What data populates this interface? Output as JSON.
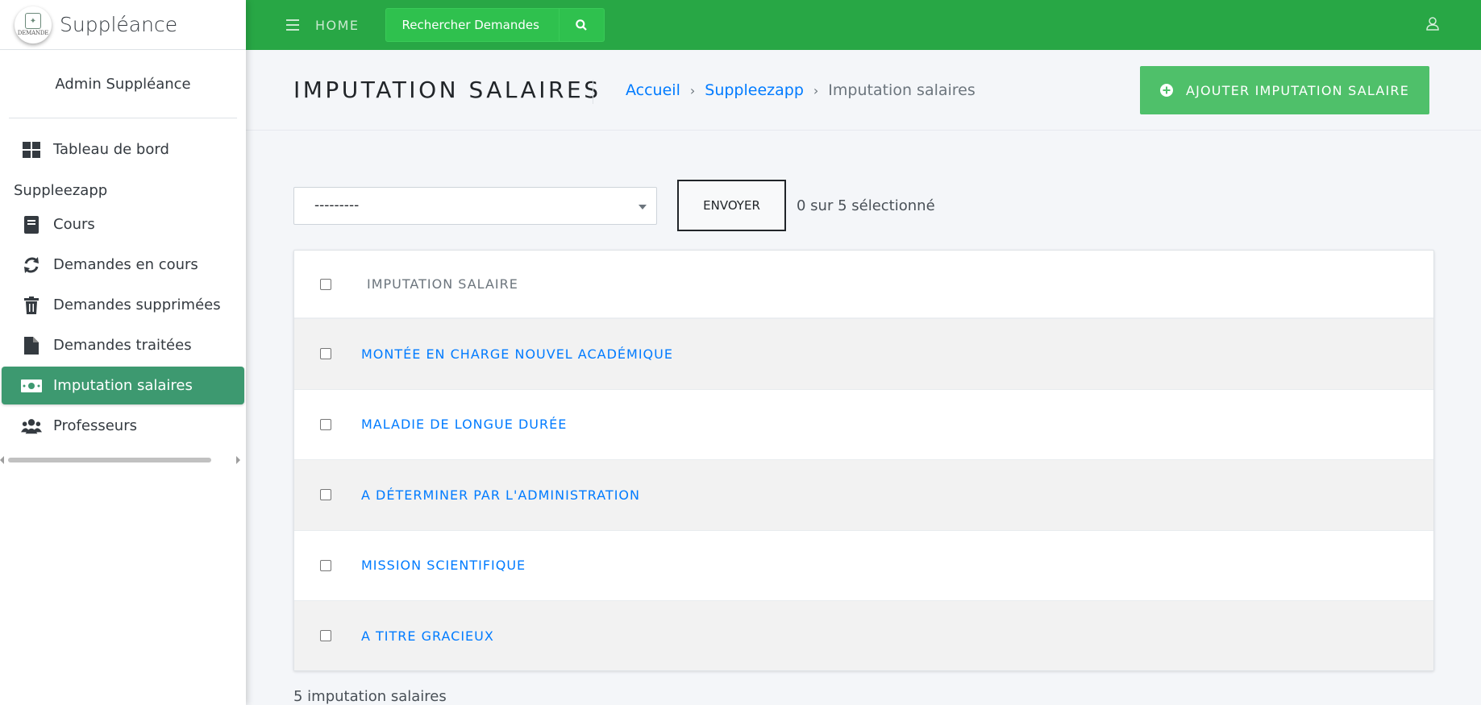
{
  "brand": {
    "title": "Suppléance",
    "logo_text": "DEMANDE"
  },
  "user": {
    "name": "Admin Suppléance"
  },
  "sidebar": {
    "dashboard": {
      "label": "Tableau de bord",
      "icon": "dashboard-icon"
    },
    "section_header": "Suppleezapp",
    "items": [
      {
        "label": "Cours",
        "icon": "book-icon"
      },
      {
        "label": "Demandes en cours",
        "icon": "sync-icon"
      },
      {
        "label": "Demandes supprimées",
        "icon": "trash-icon"
      },
      {
        "label": "Demandes traitées",
        "icon": "file-icon"
      },
      {
        "label": "Imputation salaires",
        "icon": "money-icon",
        "active": true
      },
      {
        "label": "Professeurs",
        "icon": "users-icon"
      }
    ]
  },
  "topbar": {
    "home_label": "HOME",
    "search_placeholder": "Rechercher Demandes",
    "background_color": "#28a745"
  },
  "page": {
    "title": "IMPUTATION SALAIRES",
    "breadcrumb": {
      "home": "Accueil",
      "app": "Suppleezapp",
      "current": "Imputation salaires"
    },
    "add_button_label": "AJOUTER IMPUTATION SALAIRE"
  },
  "actions": {
    "selected_option": "---------",
    "go_button_label": "ENVOYER",
    "selection_counter": "0 sur 5 sélectionné"
  },
  "table": {
    "header": "IMPUTATION SALAIRE",
    "rows": [
      "MONTÉE EN CHARGE NOUVEL ACADÉMIQUE",
      "MALADIE DE LONGUE DURÉE",
      "A DÉTERMINER PAR L'ADMINISTRATION",
      "MISSION SCIENTIFIQUE",
      "A TITRE GRACIEUX"
    ]
  },
  "footer": {
    "result_count": "5 imputation salaires"
  },
  "colors": {
    "active_nav": "#3d9970",
    "link": "#007bff",
    "add_button": "#4fc06a"
  }
}
